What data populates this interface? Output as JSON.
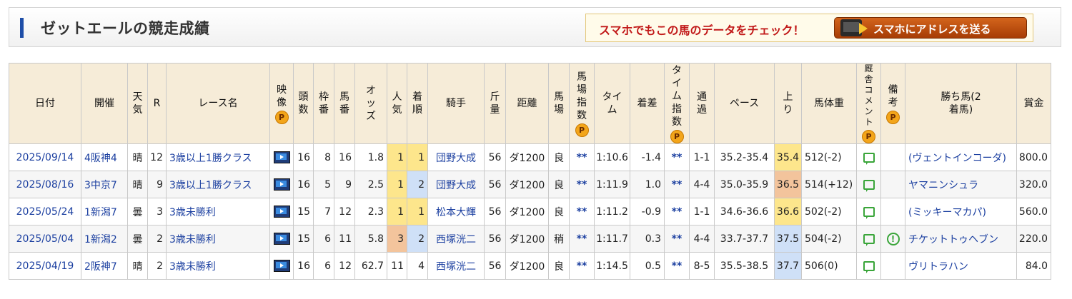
{
  "header": {
    "title": "ゼットエールの競走成績",
    "promo_text": "スマホでもこの馬のデータをチェック！",
    "promo_button": "スマホにアドレスを送る"
  },
  "table": {
    "columns": {
      "date": "日付",
      "venue": "開催",
      "weather": "天気",
      "r": "R",
      "race": "レース名",
      "video": "映像",
      "heads": "頭数",
      "waku": "枠番",
      "umaban": "馬番",
      "odds": "オッズ",
      "pop": "人気",
      "finish": "着順",
      "jockey": "騎手",
      "weight": "斤量",
      "distance": "距離",
      "track": "馬場",
      "track_index": "馬場指数",
      "time": "タイム",
      "margin": "着差",
      "time_index": "タイム指数",
      "passing": "通過",
      "pace": "ペース",
      "last3f": "上り",
      "body_weight": "馬体重",
      "stable_comment": "厩舎コメント",
      "remarks": "備考",
      "winner": "勝ち馬(2着馬)",
      "prize": "賞金",
      "p_mark": "P"
    },
    "rows": [
      {
        "date": "2025/09/14",
        "venue": "4阪神4",
        "weather": "晴",
        "r": "12",
        "race": "3歳以上1勝クラス",
        "heads": "16",
        "waku": "8",
        "umaban": "16",
        "odds": "1.8",
        "pop": "1",
        "finish": "1",
        "jockey": "団野大成",
        "weight": "56",
        "distance": "ダ1200",
        "track": "良",
        "track_index": "**",
        "time": "1:10.6",
        "margin": "-1.4",
        "time_index": "**",
        "passing": "1-1",
        "pace": "35.2-35.4",
        "last3f": "35.4",
        "body_weight": "512(-2)",
        "winner": "(ヴェントインコーダ)",
        "prize": "800.0"
      },
      {
        "date": "2025/08/16",
        "venue": "3中京7",
        "weather": "晴",
        "r": "9",
        "race": "3歳以上1勝クラス",
        "heads": "16",
        "waku": "5",
        "umaban": "9",
        "odds": "2.5",
        "pop": "1",
        "finish": "2",
        "jockey": "団野大成",
        "weight": "56",
        "distance": "ダ1200",
        "track": "良",
        "track_index": "**",
        "time": "1:11.9",
        "margin": "1.0",
        "time_index": "**",
        "passing": "4-4",
        "pace": "35.0-35.9",
        "last3f": "36.5",
        "body_weight": "514(+12)",
        "winner": "ヤマニンシュラ",
        "prize": "320.0"
      },
      {
        "date": "2025/05/24",
        "venue": "1新潟7",
        "weather": "曇",
        "r": "3",
        "race": "3歳未勝利",
        "heads": "15",
        "waku": "7",
        "umaban": "12",
        "odds": "2.3",
        "pop": "1",
        "finish": "1",
        "jockey": "松本大輝",
        "weight": "56",
        "distance": "ダ1200",
        "track": "良",
        "track_index": "**",
        "time": "1:11.2",
        "margin": "-0.9",
        "time_index": "**",
        "passing": "1-1",
        "pace": "34.6-36.6",
        "last3f": "36.6",
        "body_weight": "502(-2)",
        "winner": "(ミッキーマカパ)",
        "prize": "560.0"
      },
      {
        "date": "2025/05/04",
        "venue": "1新潟2",
        "weather": "曇",
        "r": "2",
        "race": "3歳未勝利",
        "heads": "15",
        "waku": "6",
        "umaban": "11",
        "odds": "5.8",
        "pop": "3",
        "finish": "2",
        "jockey": "西塚洸二",
        "weight": "56",
        "distance": "ダ1200",
        "track": "稍",
        "track_index": "**",
        "time": "1:11.7",
        "margin": "0.3",
        "time_index": "**",
        "passing": "4-4",
        "pace": "33.7-37.7",
        "last3f": "37.5",
        "body_weight": "504(-2)",
        "winner": "チケットトゥヘブン",
        "prize": "220.0"
      },
      {
        "date": "2025/04/19",
        "venue": "2阪神7",
        "weather": "晴",
        "r": "2",
        "race": "3歳未勝利",
        "heads": "16",
        "waku": "6",
        "umaban": "12",
        "odds": "62.7",
        "pop": "11",
        "finish": "4",
        "jockey": "西塚洸二",
        "weight": "56",
        "distance": "ダ1200",
        "track": "良",
        "track_index": "**",
        "time": "1:14.5",
        "margin": "0.5",
        "time_index": "**",
        "passing": "8-5",
        "pace": "35.5-38.5",
        "last3f": "37.7",
        "body_weight": "506(0)",
        "winner": "ヴリトラハン",
        "prize": "84.0"
      }
    ]
  }
}
